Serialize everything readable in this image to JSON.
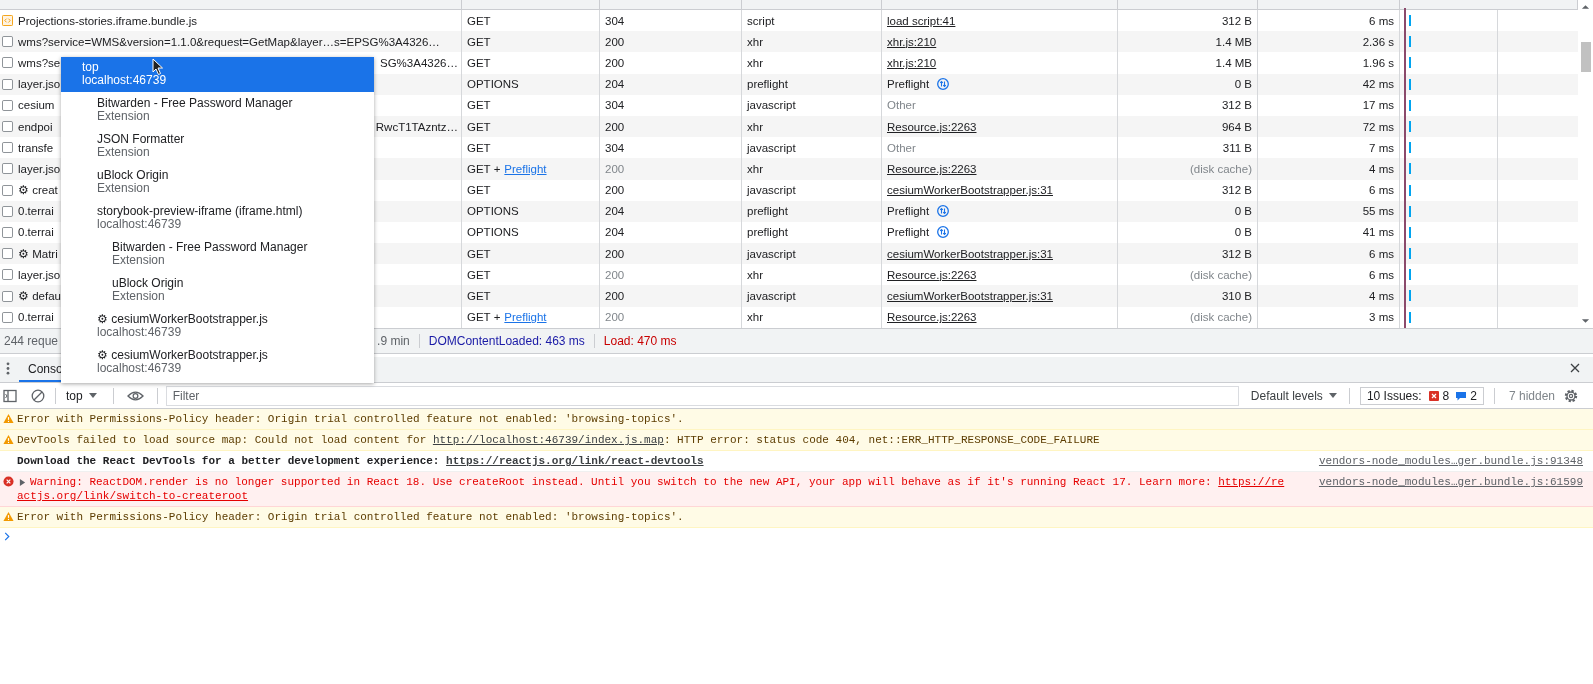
{
  "network": {
    "rows": [
      {
        "kind": "script",
        "name": "Projections-stories.iframe.bundle.js",
        "method": "GET",
        "status": "304",
        "from_cache": false,
        "type": "script",
        "initiator": {
          "kind": "link",
          "text": "load script:41"
        },
        "size": "312 B",
        "time": "6 ms"
      },
      {
        "kind": "document",
        "name": "wms?service=WMS&version=1.1.0&request=GetMap&layer…s=EPSG%3A4326…",
        "method": "GET",
        "status": "200",
        "from_cache": false,
        "type": "xhr",
        "initiator": {
          "kind": "link",
          "text": "xhr.js:210"
        },
        "size": "1.4 MB",
        "time": "2.36 s"
      },
      {
        "kind": "document",
        "name": "wms?se",
        "name_end": "SG%3A4326…",
        "method": "GET",
        "status": "200",
        "from_cache": false,
        "type": "xhr",
        "initiator": {
          "kind": "link",
          "text": "xhr.js:210"
        },
        "size": "1.4 MB",
        "time": "1.96 s"
      },
      {
        "kind": "document",
        "name": "layer.jso",
        "method": "OPTIONS",
        "status": "204",
        "from_cache": false,
        "type": "preflight",
        "initiator": {
          "kind": "preflight",
          "text": "Preflight"
        },
        "size": "0 B",
        "time": "42 ms"
      },
      {
        "kind": "document",
        "name": "cesium",
        "method": "GET",
        "status": "304",
        "from_cache": false,
        "type": "javascript",
        "initiator": {
          "kind": "other",
          "text": "Other"
        },
        "size": "312 B",
        "time": "17 ms"
      },
      {
        "kind": "document",
        "name": "endpoi",
        "name_end": "RwcT1TAzntz…",
        "method": "GET",
        "status": "200",
        "from_cache": false,
        "type": "xhr",
        "initiator": {
          "kind": "link",
          "text": "Resource.js:2263"
        },
        "size": "964 B",
        "time": "72 ms"
      },
      {
        "kind": "document",
        "name": "transfe",
        "method": "GET",
        "status": "304",
        "from_cache": false,
        "type": "javascript",
        "initiator": {
          "kind": "other",
          "text": "Other"
        },
        "size": "311 B",
        "time": "7 ms"
      },
      {
        "kind": "document",
        "name": "layer.jso",
        "method": "GET +",
        "method_link": "Preflight",
        "status": "200",
        "from_cache": true,
        "type": "xhr",
        "initiator": {
          "kind": "link",
          "text": "Resource.js:2263"
        },
        "size": "(disk cache)",
        "time": "4 ms"
      },
      {
        "kind": "document",
        "name": "⚙ creat",
        "method": "GET",
        "status": "200",
        "from_cache": false,
        "type": "javascript",
        "initiator": {
          "kind": "link",
          "text": "cesiumWorkerBootstrapper.js:31"
        },
        "size": "312 B",
        "time": "6 ms"
      },
      {
        "kind": "document",
        "name": "0.terrai",
        "method": "OPTIONS",
        "status": "204",
        "from_cache": false,
        "type": "preflight",
        "initiator": {
          "kind": "preflight",
          "text": "Preflight"
        },
        "size": "0 B",
        "time": "55 ms"
      },
      {
        "kind": "document",
        "name": "0.terrai",
        "method": "OPTIONS",
        "status": "204",
        "from_cache": false,
        "type": "preflight",
        "initiator": {
          "kind": "preflight",
          "text": "Preflight"
        },
        "size": "0 B",
        "time": "41 ms"
      },
      {
        "kind": "document",
        "name": "⚙ Matri",
        "method": "GET",
        "status": "200",
        "from_cache": false,
        "type": "javascript",
        "initiator": {
          "kind": "link",
          "text": "cesiumWorkerBootstrapper.js:31"
        },
        "size": "312 B",
        "time": "6 ms"
      },
      {
        "kind": "document",
        "name": "layer.jso",
        "method": "GET",
        "status": "200",
        "from_cache": true,
        "type": "xhr",
        "initiator": {
          "kind": "link",
          "text": "Resource.js:2263"
        },
        "size": "(disk cache)",
        "time": "6 ms"
      },
      {
        "kind": "document",
        "name": "⚙ defau",
        "method": "GET",
        "status": "200",
        "from_cache": false,
        "type": "javascript",
        "initiator": {
          "kind": "link",
          "text": "cesiumWorkerBootstrapper.js:31"
        },
        "size": "310 B",
        "time": "4 ms"
      },
      {
        "kind": "document",
        "name": "0.terrai",
        "method": "GET +",
        "method_link": "Preflight",
        "status": "200",
        "from_cache": true,
        "type": "xhr",
        "initiator": {
          "kind": "link",
          "text": "Resource.js:2263"
        },
        "size": "(disk cache)",
        "time": "3 ms"
      }
    ],
    "summary": {
      "requests": "244 reque",
      "duration": ".9 min",
      "dom_content_loaded": "DOMContentLoaded: 463 ms",
      "load": "Load: 470 ms"
    }
  },
  "context_menu": {
    "items": [
      {
        "title": "top",
        "subtitle": "localhost:46739",
        "selected": true,
        "children": [
          {
            "title": "Bitwarden - Free Password Manager",
            "subtitle": "Extension",
            "selected": false
          },
          {
            "title": "JSON Formatter",
            "subtitle": "Extension",
            "selected": false
          },
          {
            "title": "uBlock Origin",
            "subtitle": "Extension",
            "selected": false
          },
          {
            "title": "storybook-preview-iframe (iframe.html)",
            "subtitle": "localhost:46739",
            "selected": false,
            "children": [
              {
                "title": "Bitwarden - Free Password Manager",
                "subtitle": "Extension",
                "selected": false
              },
              {
                "title": "uBlock Origin",
                "subtitle": "Extension",
                "selected": false
              }
            ]
          },
          {
            "title": "⚙ cesiumWorkerBootstrapper.js",
            "subtitle": "localhost:46739",
            "selected": false
          },
          {
            "title": "⚙ cesiumWorkerBootstrapper.js",
            "subtitle": "localhost:46739",
            "selected": false
          }
        ]
      }
    ]
  },
  "drawer": {
    "tabs": [
      {
        "label": "Conso",
        "selected": true
      }
    ]
  },
  "console": {
    "context": "top",
    "filter_placeholder": "Filter",
    "levels": "Default levels",
    "issues": {
      "label": "10 Issues:",
      "errors": "8",
      "infos": "2"
    },
    "hidden": "7 hidden",
    "messages": [
      {
        "kind": "warning",
        "bold": false,
        "lines": [
          [
            {
              "text": "Error with Permissions-Policy header: Origin trial controlled feature not enabled: 'browsing-topics'."
            }
          ]
        ]
      },
      {
        "kind": "warning",
        "bold": false,
        "lines": [
          [
            {
              "text": "DevTools failed to load source map: Could not load content for "
            },
            {
              "text": "http://localhost:46739/index.js.map",
              "link": true
            },
            {
              "text": ": HTTP error: status code 404, net::ERR_HTTP_RESPONSE_CODE_FAILURE"
            }
          ]
        ]
      },
      {
        "kind": "info",
        "bold": true,
        "lines": [
          [
            {
              "text": "Download the React DevTools for a better development experience: "
            },
            {
              "text": "https://reactjs.org/link/react-devtools",
              "link": true
            }
          ]
        ],
        "source": "vendors-node_modules…ger.bundle.js:91348"
      },
      {
        "kind": "error",
        "bold": false,
        "expanded": false,
        "lines": [
          [
            {
              "text": "Warning: ReactDOM.render is no longer supported in React 18. Use createRoot instead. Until you switch to the new API, your app will behave as if it's running React 17. Learn more: "
            },
            {
              "text": "https://re",
              "link": true
            }
          ],
          [
            {
              "text": "actjs.org/link/switch-to-createroot",
              "link": true
            }
          ]
        ],
        "source": "vendors-node_modules…ger.bundle.js:61599"
      },
      {
        "kind": "warning",
        "bold": false,
        "lines": [
          [
            {
              "text": "Error with Permissions-Policy header: Origin trial controlled feature not enabled: 'browsing-topics'."
            }
          ]
        ]
      }
    ]
  }
}
